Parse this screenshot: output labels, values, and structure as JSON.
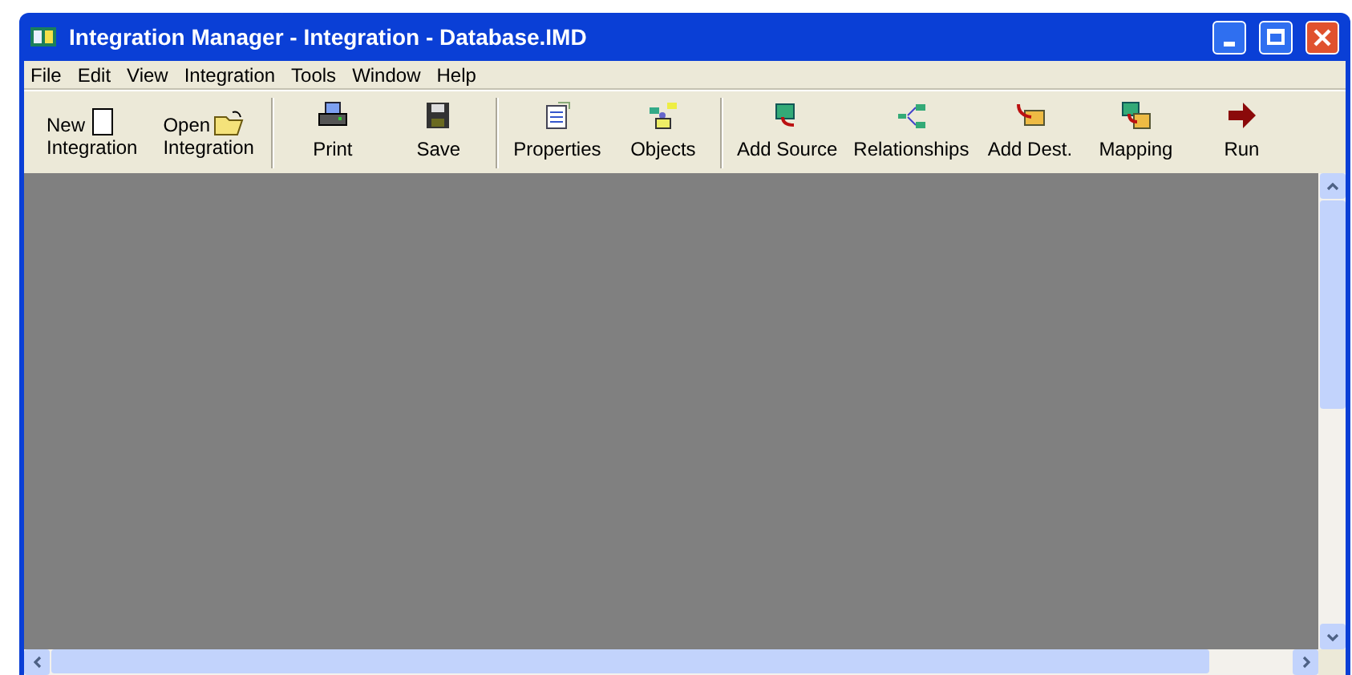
{
  "window": {
    "title": "Integration Manager - Integration - Database.IMD"
  },
  "menu": [
    "File",
    "Edit",
    "View",
    "Integration",
    "Tools",
    "Window",
    "Help"
  ],
  "toolbar_groups": [
    [
      {
        "kind": "inline",
        "label_top": "New",
        "label": "Integration"
      },
      {
        "kind": "inline",
        "label_top": "Open",
        "label": "Integration"
      }
    ],
    [
      {
        "kind": "stacked",
        "label": "Print"
      },
      {
        "kind": "stacked",
        "label": "Save"
      }
    ],
    [
      {
        "kind": "stacked",
        "label": "Properties"
      },
      {
        "kind": "stacked",
        "label": "Objects"
      }
    ],
    [
      {
        "kind": "stacked",
        "label": "Add Source"
      },
      {
        "kind": "stacked",
        "label": "Relationships"
      },
      {
        "kind": "stacked",
        "label": "Add Dest."
      },
      {
        "kind": "stacked",
        "label": "Mapping"
      },
      {
        "kind": "stacked",
        "label": "Run"
      }
    ]
  ]
}
